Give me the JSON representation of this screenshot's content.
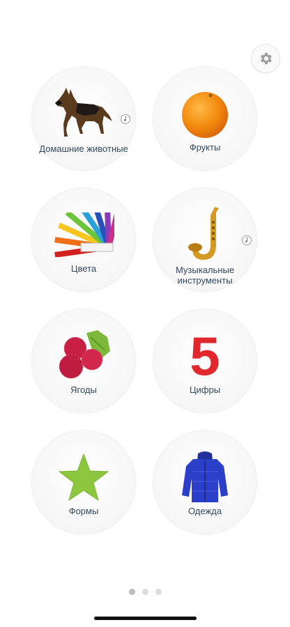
{
  "settings": {
    "icon": "gear-icon"
  },
  "categories": [
    {
      "label": "Домашние животные",
      "icon": "dog-image",
      "has_audio": true
    },
    {
      "label": "Фрукты",
      "icon": "orange-image",
      "has_audio": false
    },
    {
      "label": "Цвета",
      "icon": "color-fan-image",
      "has_audio": false
    },
    {
      "label": "Музыкальные инструменты",
      "icon": "saxophone-image",
      "has_audio": true
    },
    {
      "label": "Ягоды",
      "icon": "raspberry-image",
      "has_audio": false
    },
    {
      "label": "Цифры",
      "icon": "number-five-image",
      "digit": "5",
      "has_audio": false
    },
    {
      "label": "Формы",
      "icon": "star-shape-image",
      "has_audio": false
    },
    {
      "label": "Одежда",
      "icon": "jacket-image",
      "has_audio": false
    }
  ],
  "pagination": {
    "pages": 3,
    "current": 1
  },
  "colors": {
    "label": "#34495e",
    "digit": "#e0282e",
    "star": "#8cc63f",
    "jacket": "#2c3fc9",
    "orange": "#f28a0e"
  }
}
